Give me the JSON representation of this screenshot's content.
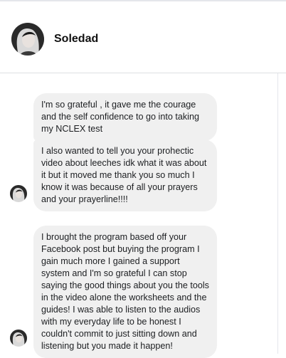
{
  "conversation": {
    "contact_name": "Soledad"
  },
  "messages": [
    {
      "text": "I'm so grateful , it gave me the courage\nand the self confidence to go into taking\nmy NCLEX test"
    },
    {
      "text": "I also wanted to tell you your prohectic\nvideo about leeches idk what it was about\nit but it moved me thank you so much I\nknow it was because of all your prayers\nand your prayerline!!!!"
    },
    {
      "text": "I brought the program based off your\nFacebook post but buying the program I\ngain much more I gained a support\nsystem and I'm so grateful I can stop\nsaying the good things about you the tools\nin the video alone the worksheets and the\nguides! I was able to listen to the audios\nwith my everyday life to be honest I\ncouldn't commit to just sitting down and\nlistening but you made it happen!"
    }
  ],
  "colors": {
    "bubble": "#f0f0f0",
    "text": "#1c1e21",
    "divider": "#dddfe2"
  }
}
